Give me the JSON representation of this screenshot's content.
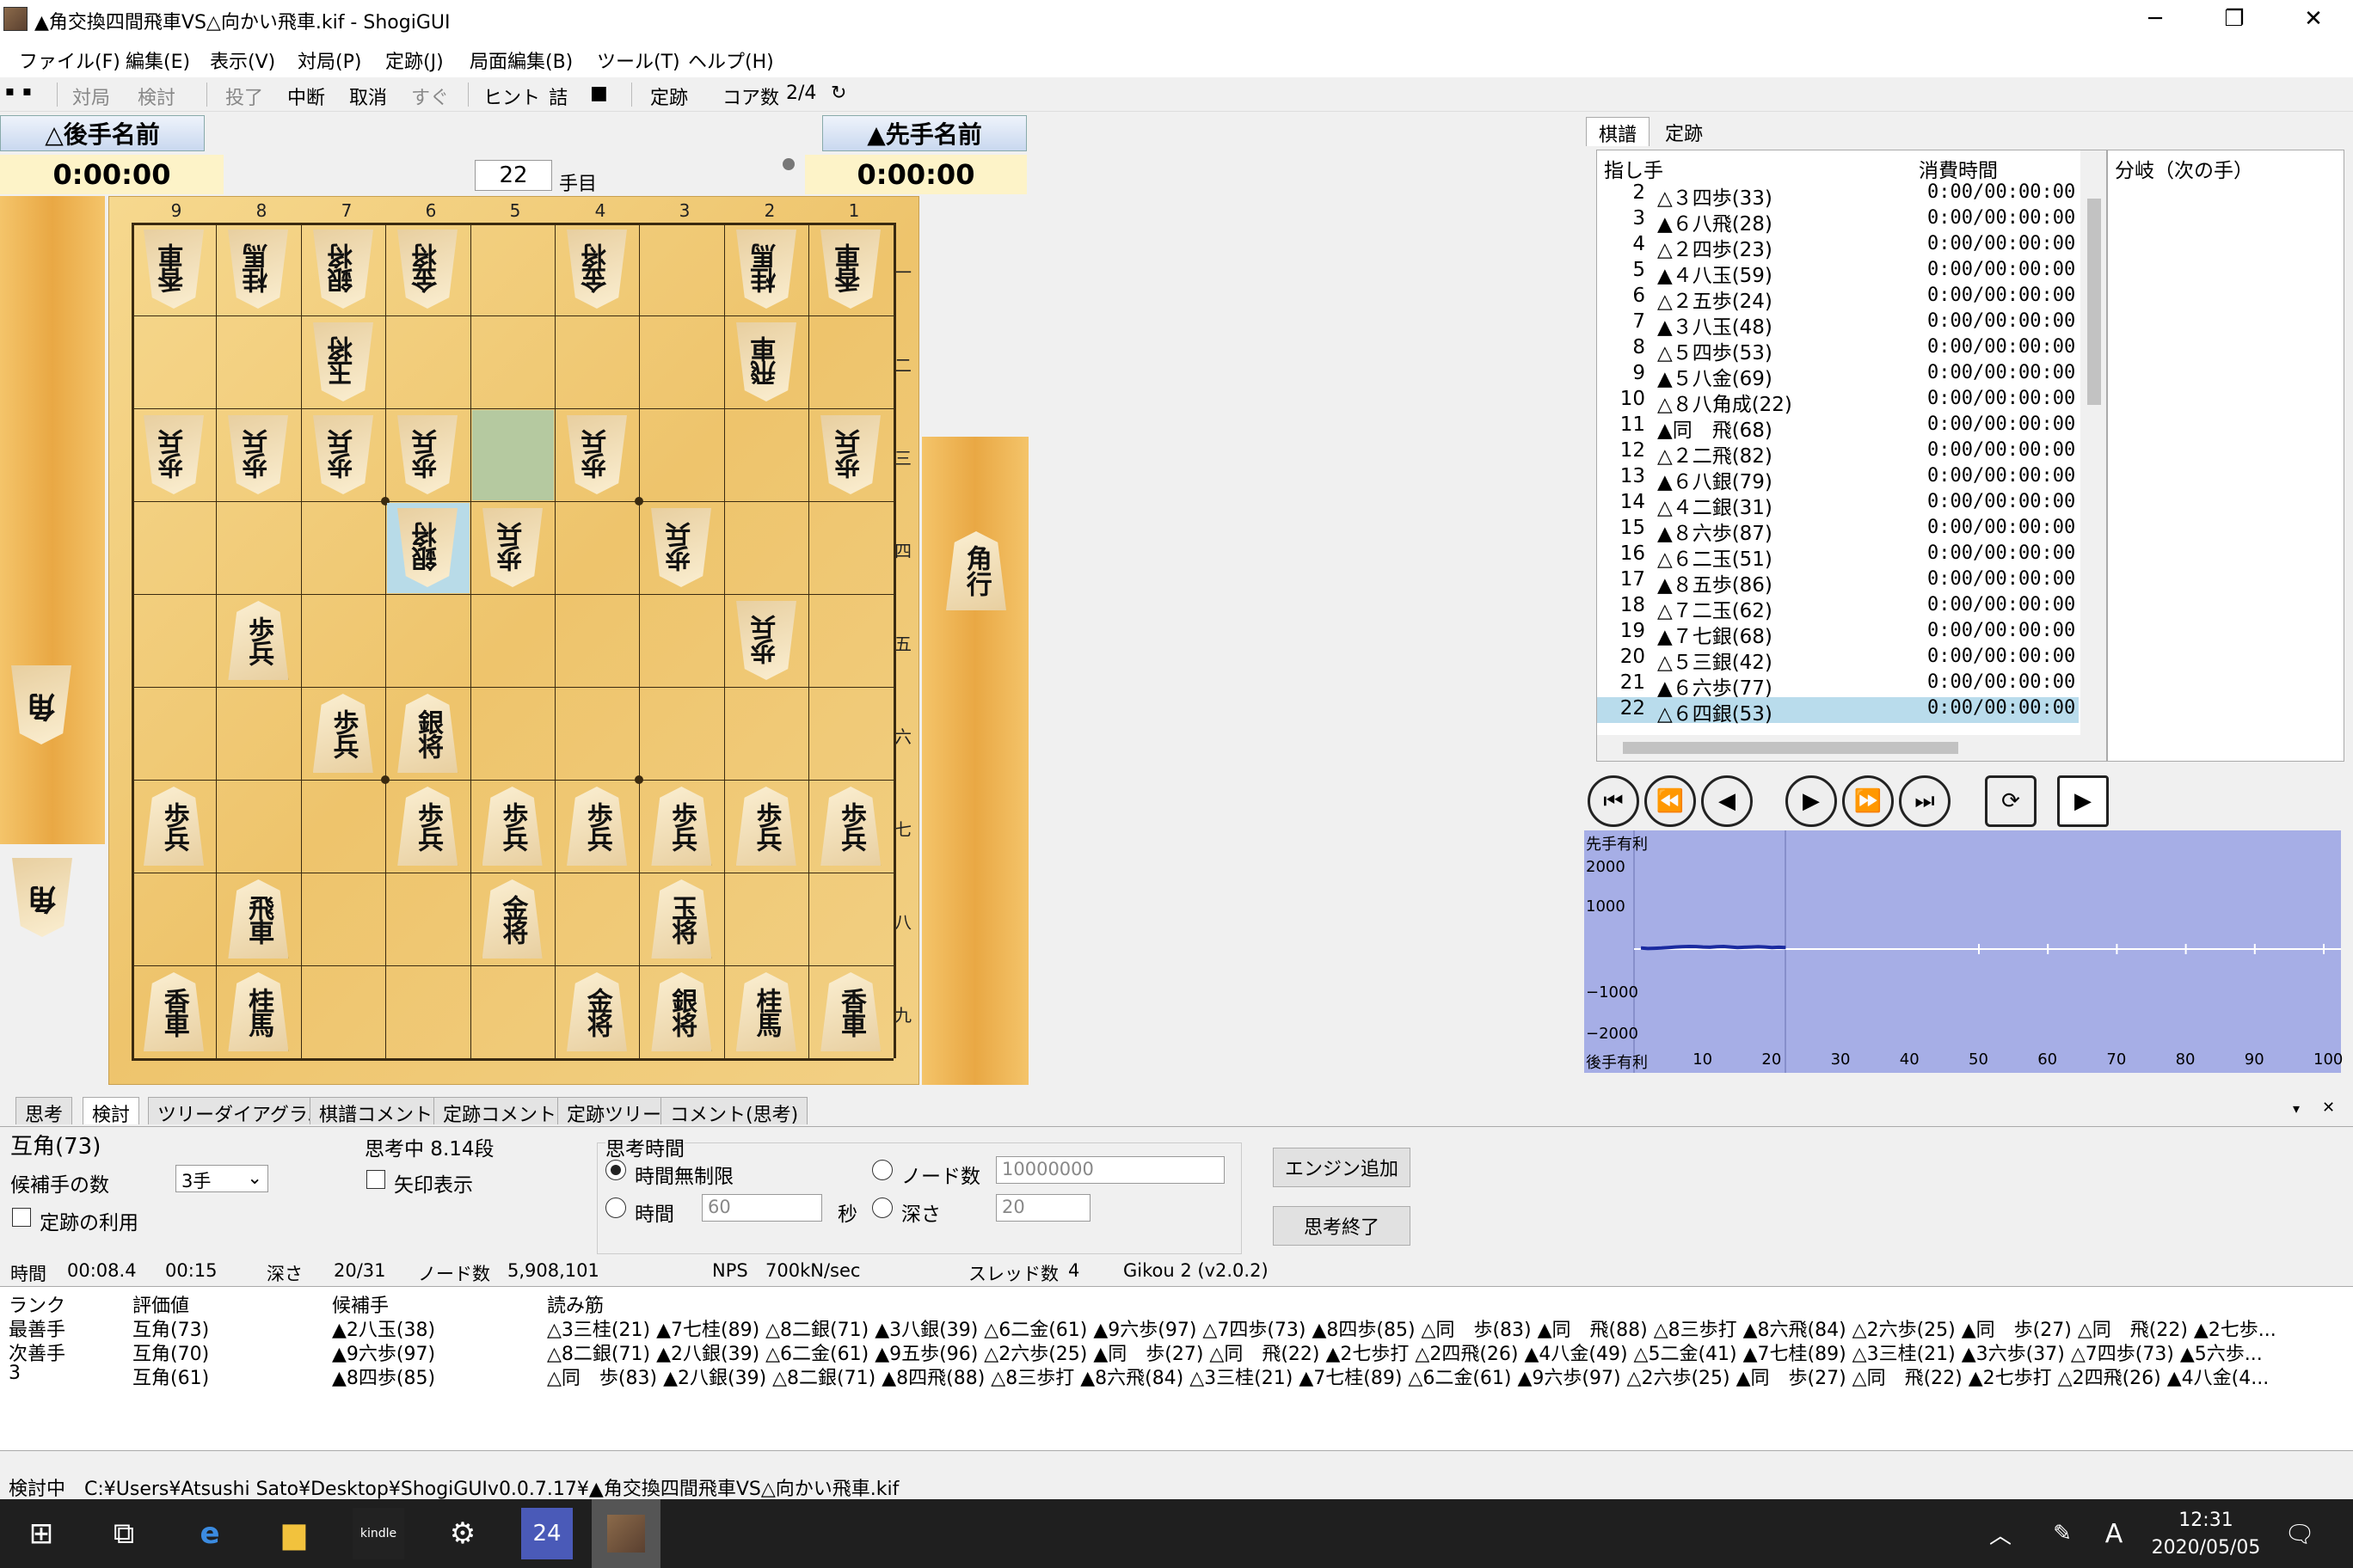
{
  "window": {
    "title": "▲角交換四間飛車VS△向かい飛車.kif - ShogiGUI",
    "minimize": "─",
    "restore": "❐",
    "close": "✕"
  },
  "menu": [
    "ファイル(F)",
    "編集(E)",
    "表示(V)",
    "対局(P)",
    "定跡(J)",
    "局面編集(B)",
    "ツール(T)",
    "ヘルプ(H)"
  ],
  "toolbar": {
    "items": [
      "対局",
      "検討",
      "投了",
      "中断",
      "取消",
      "すぐ",
      "ヒント",
      "詰",
      "■",
      "定跡",
      "コア数"
    ],
    "cores": "2/4"
  },
  "players": {
    "gote_name": "△後手名前",
    "sente_name": "▲先手名前",
    "gote_time": "0:00:00",
    "sente_time": "0:00:00",
    "move_no": "22",
    "move_suffix": "手目"
  },
  "board": {
    "files": [
      "9",
      "8",
      "7",
      "6",
      "5",
      "4",
      "3",
      "2",
      "1"
    ],
    "ranks": [
      "一",
      "二",
      "三",
      "四",
      "五",
      "六",
      "七",
      "八",
      "九"
    ],
    "gote_hand": "角",
    "sente_hand": "角行"
  },
  "right_tabs": [
    "棋譜",
    "定跡"
  ],
  "kifu": {
    "header_move": "指し手",
    "header_time": "消費時間",
    "bunki_header": "分岐（次の手）",
    "rows": [
      [
        "2",
        "△３四歩(33)",
        "0:00/00:00:00"
      ],
      [
        "3",
        "▲６八飛(28)",
        "0:00/00:00:00"
      ],
      [
        "4",
        "△２四歩(23)",
        "0:00/00:00:00"
      ],
      [
        "5",
        "▲４八玉(59)",
        "0:00/00:00:00"
      ],
      [
        "6",
        "△２五歩(24)",
        "0:00/00:00:00"
      ],
      [
        "7",
        "▲３八玉(48)",
        "0:00/00:00:00"
      ],
      [
        "8",
        "△５四歩(53)",
        "0:00/00:00:00"
      ],
      [
        "9",
        "▲５八金(69)",
        "0:00/00:00:00"
      ],
      [
        "10",
        "△８八角成(22)",
        "0:00/00:00:00"
      ],
      [
        "11",
        "▲同　飛(68)",
        "0:00/00:00:00"
      ],
      [
        "12",
        "△２二飛(82)",
        "0:00/00:00:00"
      ],
      [
        "13",
        "▲６八銀(79)",
        "0:00/00:00:00"
      ],
      [
        "14",
        "△４二銀(31)",
        "0:00/00:00:00"
      ],
      [
        "15",
        "▲８六歩(87)",
        "0:00/00:00:00"
      ],
      [
        "16",
        "△６二玉(51)",
        "0:00/00:00:00"
      ],
      [
        "17",
        "▲８五歩(86)",
        "0:00/00:00:00"
      ],
      [
        "18",
        "△７二玉(62)",
        "0:00/00:00:00"
      ],
      [
        "19",
        "▲７七銀(68)",
        "0:00/00:00:00"
      ],
      [
        "20",
        "△５三銀(42)",
        "0:00/00:00:00"
      ],
      [
        "21",
        "▲６六歩(77)",
        "0:00/00:00:00"
      ],
      [
        "22",
        "△６四銀(53)",
        "0:00/00:00:00"
      ]
    ]
  },
  "graph": {
    "top_label": "先手有利",
    "bottom_label": "後手有利",
    "y_ticks": [
      "2000",
      "1000",
      "−1000",
      "−2000"
    ],
    "x_ticks": [
      "10",
      "20",
      "30",
      "40",
      "50",
      "60",
      "70",
      "80",
      "90",
      "100"
    ],
    "line_color": "#1a2aa0",
    "bg_color": "#a6aee6"
  },
  "bottom_tabs": [
    "思考",
    "検討",
    "ツリーダイアグラム",
    "棋譜コメント",
    "定跡コメント",
    "定跡ツリー",
    "コメント(思考)"
  ],
  "analysis": {
    "eval": "互角(73)",
    "thinking": "思考中 8.14段",
    "candidates_label": "候補手の数",
    "candidates_value": "3手",
    "arrow_label": "矢印表示",
    "joseki_label": "定跡の利用",
    "think_time_label": "思考時間",
    "unlimited_label": "時間無制限",
    "time_label": "時間",
    "time_value": "60",
    "sec_label": "秒",
    "node_label": "ノード数",
    "node_value": "10000000",
    "depth_label": "深さ",
    "depth_value": "20",
    "add_engine": "エンジン追加",
    "stop": "思考終了"
  },
  "stats": {
    "time_label": "時間",
    "time_value": "00:08.4",
    "time_total": "00:15",
    "depth_label": "深さ",
    "depth_value": "20/31",
    "nodes_label": "ノード数",
    "nodes_value": "5,908,101",
    "nps_label": "NPS",
    "nps_value": "700kN/sec",
    "threads_label": "スレッド数",
    "threads_value": "4",
    "engine": "Gikou 2 (v2.0.2)"
  },
  "pv": {
    "headers": [
      "ランク",
      "評価値",
      "候補手",
      "読み筋"
    ],
    "rows": [
      [
        "最善手",
        "互角(73)",
        "▲2八玉(38)",
        "△3三桂(21) ▲7七桂(89) △8二銀(71) ▲3八銀(39) △6二金(61) ▲9六歩(97) △7四歩(73) ▲8四歩(85) △同　歩(83) ▲同　飛(88) △8三歩打 ▲8六飛(84) △2六歩(25) ▲同　歩(27) △同　飛(22) ▲2七歩..."
      ],
      [
        "次善手",
        "互角(70)",
        "▲9六歩(97)",
        "△8二銀(71) ▲2八銀(39) △6二金(61) ▲9五歩(96) △2六歩(25) ▲同　歩(27) △同　飛(22) ▲2七歩打 △2四飛(26) ▲4八金(49) △5二金(41) ▲7七桂(89) △3三桂(21) ▲3六歩(37) △7四歩(73) ▲5六歩..."
      ],
      [
        "3",
        "互角(61)",
        "▲8四歩(85)",
        "△同　歩(83) ▲2八銀(39) △8二銀(71) ▲8四飛(88) △8三歩打 ▲8六飛(84) △3三桂(21) ▲7七桂(89) △6二金(61) ▲9六歩(97) △2六歩(25) ▲同　歩(27) △同　飛(22) ▲2七歩打 △2四飛(26) ▲4八金(4..."
      ]
    ]
  },
  "status": {
    "label": "検討中",
    "path": "C:¥Users¥Atsushi Sato¥Desktop¥ShogiGUIv0.0.7.17¥▲角交換四間飛車VS△向かい飛車.kif"
  },
  "taskbar": {
    "time": "12:31",
    "date": "2020/05/05",
    "ime": "A"
  }
}
